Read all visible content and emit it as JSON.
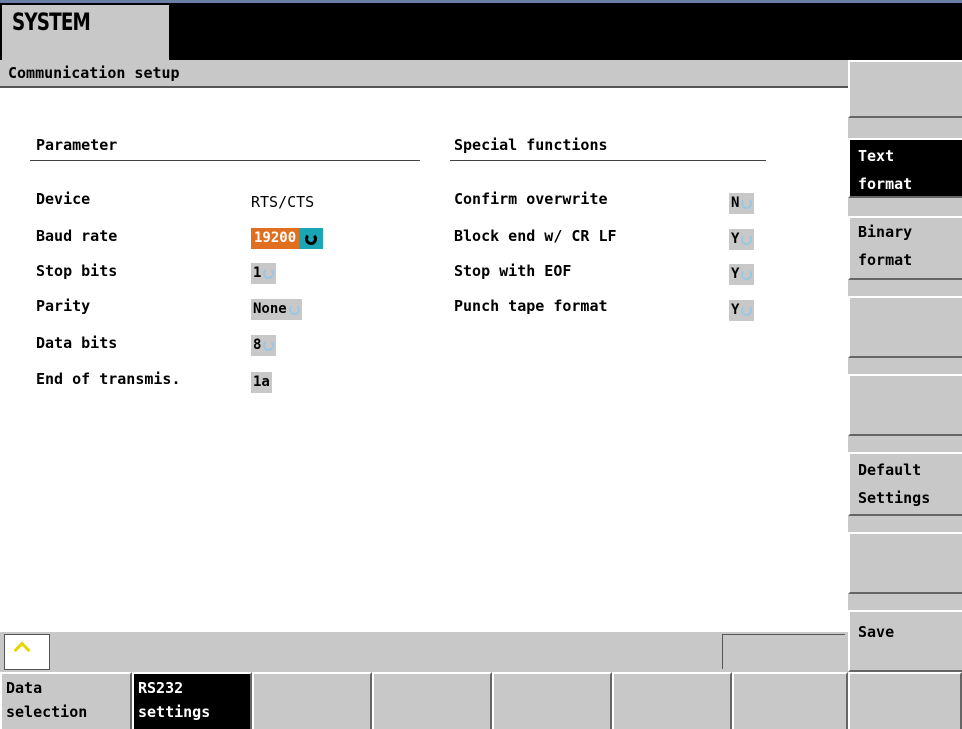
{
  "window": {
    "title": "SYSTEM"
  },
  "header": {
    "title": "Communication setup"
  },
  "parameter": {
    "heading": "Parameter",
    "rows": [
      {
        "label": "Device",
        "value": "RTS/CTS"
      },
      {
        "label": "Baud rate",
        "value": "19200"
      },
      {
        "label": "Stop bits",
        "value": "1"
      },
      {
        "label": "Parity",
        "value": "None"
      },
      {
        "label": "Data bits",
        "value": "8"
      },
      {
        "label": "End of transmis.",
        "value": "1a"
      }
    ]
  },
  "special": {
    "heading": "Special functions",
    "rows": [
      {
        "label": "Confirm overwrite",
        "value": "N"
      },
      {
        "label": "Block end w/ CR LF",
        "value": "Y"
      },
      {
        "label": "Stop with EOF",
        "value": "Y"
      },
      {
        "label": "Punch tape format",
        "value": "Y"
      }
    ]
  },
  "softkeys_right": [
    {
      "line1": "",
      "line2": ""
    },
    {
      "line1": "Text",
      "line2": "format"
    },
    {
      "line1": "Binary",
      "line2": "format"
    },
    {
      "line1": "",
      "line2": ""
    },
    {
      "line1": "",
      "line2": ""
    },
    {
      "line1": "Default",
      "line2": "Settings"
    },
    {
      "line1": "",
      "line2": ""
    },
    {
      "line1": "Save",
      "line2": ""
    }
  ],
  "softkeys_bottom": [
    {
      "line1": "Data",
      "line2": "selection"
    },
    {
      "line1": "RS232",
      "line2": "settings"
    }
  ],
  "colors": {
    "active_field": "#e07020",
    "active_cycle": "#1aa7b5",
    "panel_gray": "#c8c8c8",
    "caret": "#e6d600"
  }
}
